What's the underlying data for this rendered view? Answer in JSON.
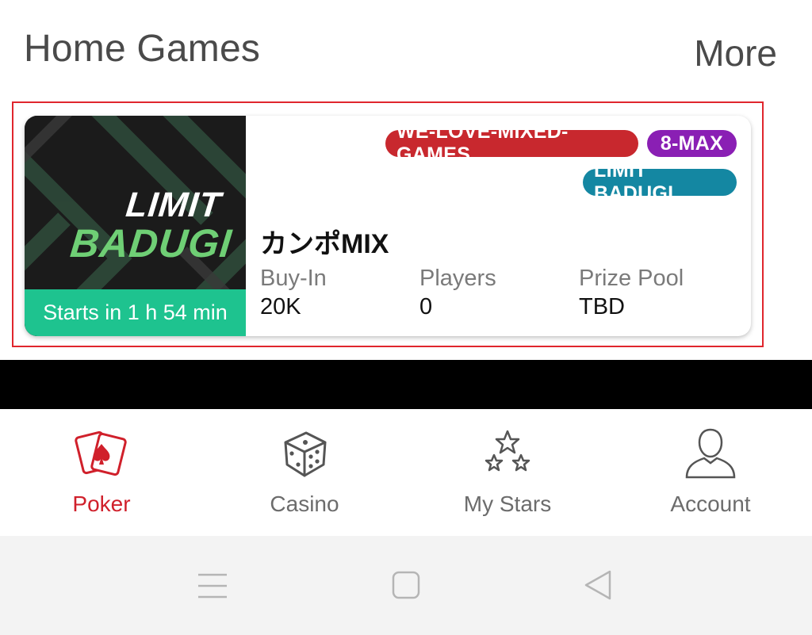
{
  "header": {
    "title": "Home Games",
    "more_label": "More"
  },
  "game_card": {
    "thumbnail": {
      "line1": "LIMIT",
      "line2": "BADUGI",
      "starts_in": "Starts in 1 h 54 min"
    },
    "tags": [
      {
        "label": "WE-LOVE-MIXED-GAMES",
        "color": "#c8282e"
      },
      {
        "label": "8-MAX",
        "color": "#8a1fb4"
      },
      {
        "label": "LIMIT BADUGI",
        "color": "#1487a2"
      }
    ],
    "name": "カンポMIX",
    "stats": [
      {
        "label": "Buy-In",
        "value": "20K"
      },
      {
        "label": "Players",
        "value": "0"
      },
      {
        "label": "Prize Pool",
        "value": "TBD"
      }
    ]
  },
  "bottom_nav": {
    "items": [
      {
        "label": "Poker",
        "icon": "poker-cards-icon",
        "active": true
      },
      {
        "label": "Casino",
        "icon": "dice-icon",
        "active": false
      },
      {
        "label": "My Stars",
        "icon": "stars-icon",
        "active": false
      },
      {
        "label": "Account",
        "icon": "user-icon",
        "active": false
      }
    ]
  },
  "system_bar": {
    "buttons": [
      "menu-icon",
      "home-square-icon",
      "back-triangle-icon"
    ]
  },
  "colors": {
    "accent_red": "#d0202b",
    "starts_bar": "#1ec38f",
    "highlight_border": "#e0262d"
  }
}
